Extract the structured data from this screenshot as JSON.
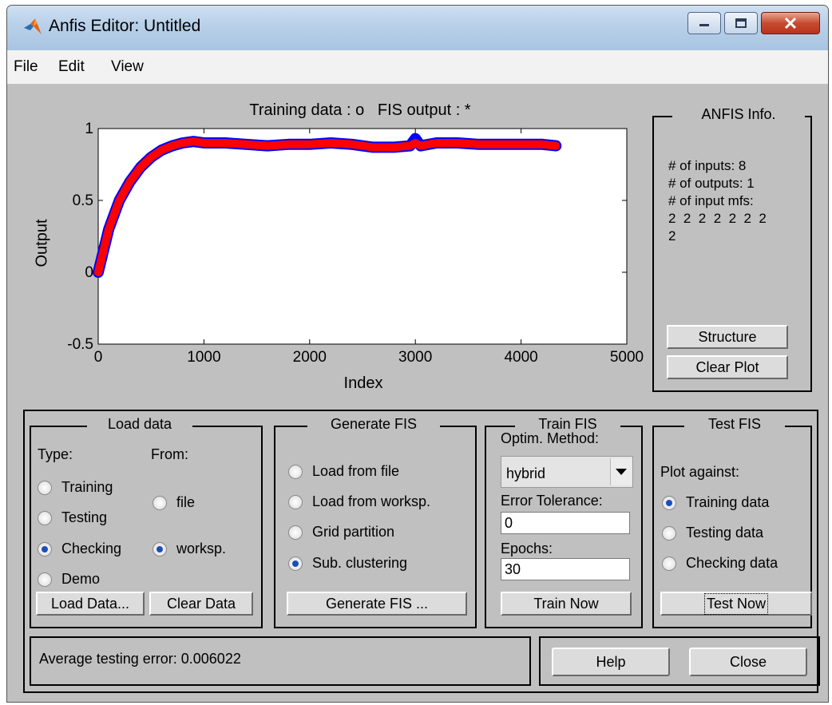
{
  "window": {
    "title": "Anfis Editor: Untitled",
    "controls": {
      "minimize": "minimize-icon",
      "maximize": "maximize-icon",
      "close": "close-icon"
    }
  },
  "menu": [
    "File",
    "Edit",
    "View"
  ],
  "plot": {
    "title": "Training data : o   FIS output : *",
    "xlabel": "Index",
    "ylabel": "Output"
  },
  "chart_data": {
    "type": "line",
    "xlim": [
      0,
      5000
    ],
    "ylim": [
      -0.5,
      1
    ],
    "x_ticks": [
      "0",
      "1000",
      "2000",
      "3000",
      "4000",
      "5000"
    ],
    "y_ticks": [
      "1",
      "0.5",
      "0",
      "-0.5"
    ],
    "grid": false,
    "series": [
      {
        "marker": "o",
        "color": "#0000ff",
        "x": [
          0,
          100,
          200,
          300,
          400,
          500,
          600,
          700,
          800,
          900,
          1000,
          1200,
          1400,
          1600,
          1800,
          2000,
          2200,
          2400,
          2600,
          2800,
          2950,
          3000,
          3050,
          3200,
          3400,
          3600,
          3800,
          4000,
          4200,
          4330
        ],
        "y": [
          0.0,
          0.3,
          0.5,
          0.63,
          0.73,
          0.8,
          0.85,
          0.88,
          0.9,
          0.91,
          0.9,
          0.9,
          0.89,
          0.88,
          0.89,
          0.89,
          0.9,
          0.89,
          0.87,
          0.87,
          0.88,
          0.93,
          0.88,
          0.9,
          0.9,
          0.89,
          0.89,
          0.89,
          0.89,
          0.88
        ]
      },
      {
        "marker": "*",
        "color": "#ff0000",
        "x": [
          0,
          100,
          200,
          300,
          400,
          500,
          600,
          700,
          800,
          900,
          1000,
          1200,
          1400,
          1600,
          1800,
          2000,
          2200,
          2400,
          2600,
          2800,
          2950,
          3000,
          3050,
          3200,
          3400,
          3600,
          3800,
          4000,
          4200,
          4330
        ],
        "y": [
          0.0,
          0.3,
          0.5,
          0.63,
          0.73,
          0.8,
          0.85,
          0.88,
          0.9,
          0.91,
          0.9,
          0.9,
          0.89,
          0.88,
          0.89,
          0.89,
          0.9,
          0.89,
          0.87,
          0.87,
          0.88,
          0.9,
          0.88,
          0.9,
          0.9,
          0.89,
          0.89,
          0.89,
          0.89,
          0.88
        ]
      }
    ]
  },
  "anfis_info": {
    "title": "ANFIS Info.",
    "lines": [
      "# of inputs: 8",
      "# of outputs: 1",
      "# of input mfs:",
      "2  2  2  2  2  2  2",
      "2"
    ],
    "structure_button": "Structure",
    "clear_plot_button": "Clear Plot"
  },
  "load_data": {
    "title": "Load data",
    "type_label": "Type:",
    "from_label": "From:",
    "type_options": [
      {
        "label": "Training",
        "selected": false
      },
      {
        "label": "Testing",
        "selected": false
      },
      {
        "label": "Checking",
        "selected": true
      },
      {
        "label": "Demo",
        "selected": false
      }
    ],
    "from_options": [
      {
        "label": "file",
        "selected": false
      },
      {
        "label": "worksp.",
        "selected": true
      }
    ],
    "load_button": "Load Data...",
    "clear_button": "Clear Data"
  },
  "generate_fis": {
    "title": "Generate FIS",
    "options": [
      {
        "label": "Load from file",
        "selected": false
      },
      {
        "label": "Load from worksp.",
        "selected": false
      },
      {
        "label": "Grid partition",
        "selected": false
      },
      {
        "label": "Sub. clustering",
        "selected": true
      }
    ],
    "button": "Generate FIS ..."
  },
  "train_fis": {
    "title": "Train FIS",
    "method_label": "Optim. Method:",
    "method_value": "hybrid",
    "error_label": "Error Tolerance:",
    "error_value": "0",
    "epochs_label": "Epochs:",
    "epochs_value": "30",
    "button": "Train Now"
  },
  "test_fis": {
    "title": "Test FIS",
    "plot_against_label": "Plot against:",
    "options": [
      {
        "label": "Training data",
        "selected": true
      },
      {
        "label": "Testing data",
        "selected": false
      },
      {
        "label": "Checking data",
        "selected": false
      }
    ],
    "button": "Test Now"
  },
  "status": {
    "text": "Average testing error: 0.006022"
  },
  "help_button": "Help",
  "close_button": "Close"
}
